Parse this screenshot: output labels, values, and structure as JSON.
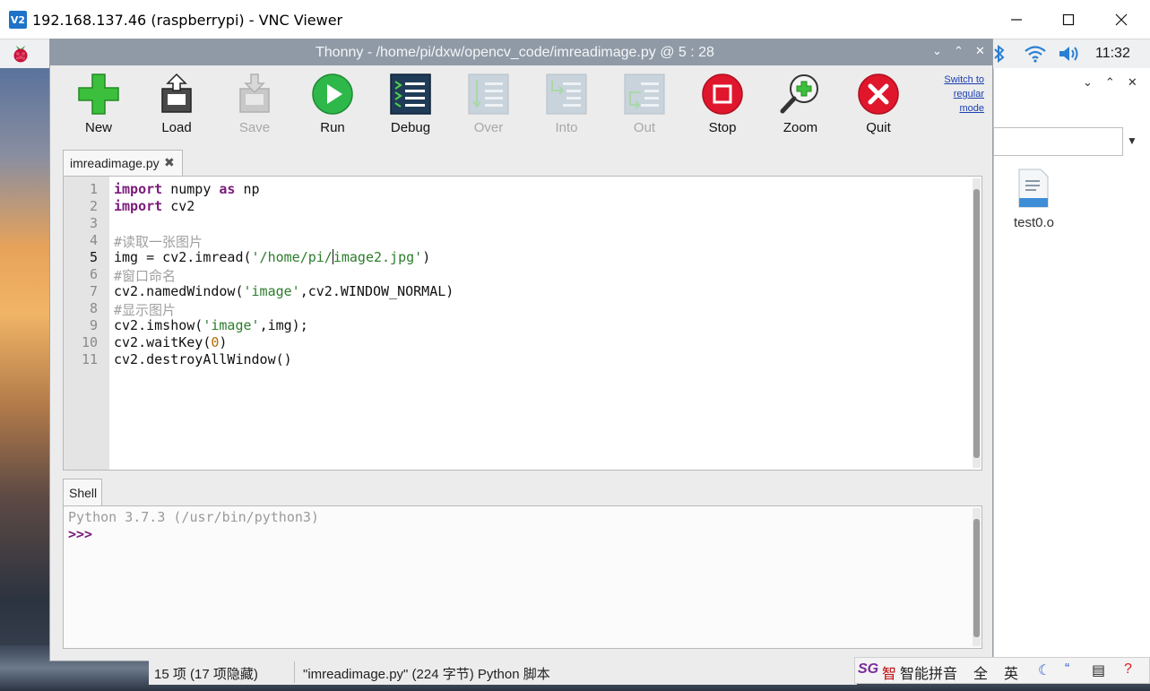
{
  "vnc": {
    "logo_text": "V2",
    "title": "192.168.137.46 (raspberrypi) - VNC Viewer"
  },
  "panel": {
    "clock": "11:32"
  },
  "thonny": {
    "title": "Thonny  -  /home/pi/dxw/opencv_code/imreadimage.py  @  5 : 28",
    "switch_mode": [
      "Switch to",
      "regular",
      "mode"
    ],
    "toolbar": [
      {
        "label": "New",
        "icon": "new-icon",
        "enabled": true
      },
      {
        "label": "Load",
        "icon": "load-icon",
        "enabled": true
      },
      {
        "label": "Save",
        "icon": "save-icon",
        "enabled": false
      },
      {
        "label": "Run",
        "icon": "run-icon",
        "enabled": true
      },
      {
        "label": "Debug",
        "icon": "debug-icon",
        "enabled": true
      },
      {
        "label": "Over",
        "icon": "step-over-icon",
        "enabled": false
      },
      {
        "label": "Into",
        "icon": "step-into-icon",
        "enabled": false
      },
      {
        "label": "Out",
        "icon": "step-out-icon",
        "enabled": false
      },
      {
        "label": "Stop",
        "icon": "stop-icon",
        "enabled": true
      },
      {
        "label": "Zoom",
        "icon": "zoom-icon",
        "enabled": true
      },
      {
        "label": "Quit",
        "icon": "quit-icon",
        "enabled": true
      }
    ],
    "editor": {
      "tab_label": "imreadimage.py",
      "close_glyph": "✖",
      "line_numbers": [
        "1",
        "2",
        "3",
        "4",
        "5",
        "6",
        "7",
        "8",
        "9",
        "10",
        "11"
      ],
      "current_line": "5",
      "lines": {
        "l1_kw1": "import",
        "l1_mid": " numpy ",
        "l1_kw2": "as",
        "l1_end": " np",
        "l2_kw": "import",
        "l2_end": " cv2",
        "l4": "#读取一张图片",
        "l5_a": "img = cv2.imread(",
        "l5_str1": "'/home/pi/",
        "l5_str2": "image2.jpg'",
        "l5_end": ")",
        "l6": "#窗口命名",
        "l7_a": "cv2.namedWindow(",
        "l7_str": "'image'",
        "l7_end": ",cv2.WINDOW_NORMAL)",
        "l8": "#显示图片",
        "l9_a": "cv2.imshow(",
        "l9_str": "'image'",
        "l9_end": ",img);",
        "l10_a": "cv2.waitKey(",
        "l10_num": "0",
        "l10_end": ")",
        "l11": "cv2.destroyAllWindow()"
      }
    },
    "shell": {
      "tab_label": "Shell",
      "banner": "Python 3.7.3 (/usr/bin/python3)",
      "prompt": ">>>"
    }
  },
  "file_manager": {
    "file_label": "test0.o"
  },
  "statusbar": {
    "items": "15 项 (17 项隐藏)",
    "file_info": "\"imreadimage.py\" (224 字节) Python 脚本"
  },
  "ime": {
    "logo": "SG",
    "zhi": "智",
    "name": "智能拼音",
    "full": "全",
    "eng": "英"
  }
}
